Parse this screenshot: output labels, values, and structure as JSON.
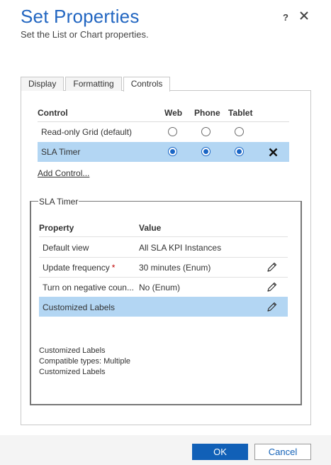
{
  "dialog": {
    "title": "Set Properties",
    "subtitle": "Set the List or Chart properties.",
    "help_label": "?"
  },
  "tabs": [
    {
      "label": "Display",
      "active": false
    },
    {
      "label": "Formatting",
      "active": false
    },
    {
      "label": "Controls",
      "active": true
    }
  ],
  "controls_table": {
    "headers": {
      "control": "Control",
      "web": "Web",
      "phone": "Phone",
      "tablet": "Tablet"
    },
    "rows": [
      {
        "label": "Read-only Grid (default)",
        "web": false,
        "phone": false,
        "tablet": false,
        "selected": false
      },
      {
        "label": "SLA Timer",
        "web": true,
        "phone": true,
        "tablet": true,
        "selected": true
      }
    ],
    "add_control_label": "Add Control..."
  },
  "control_group": {
    "legend": "SLA Timer",
    "headers": {
      "property": "Property",
      "value": "Value"
    },
    "rows": [
      {
        "property": "Default view",
        "required": false,
        "value": "All SLA KPI Instances",
        "editable": false,
        "selected": false
      },
      {
        "property": "Update frequency",
        "required": true,
        "required_mark": "*",
        "value": "30 minutes (Enum)",
        "editable": true,
        "selected": false
      },
      {
        "property": "Turn on negative coun...",
        "required": false,
        "value": "No (Enum)",
        "editable": true,
        "selected": false
      },
      {
        "property": "Customized Labels",
        "required": false,
        "value": "",
        "editable": true,
        "selected": true
      }
    ],
    "description": {
      "line1": "Customized Labels",
      "line2": "Compatible types: Multiple",
      "line3": "Customized Labels"
    }
  },
  "footer": {
    "ok_label": "OK",
    "cancel_label": "Cancel"
  },
  "colors": {
    "title": "#2266c1",
    "selection": "#b3d6f3",
    "primary_button": "#1160b7",
    "required": "#c00000"
  }
}
